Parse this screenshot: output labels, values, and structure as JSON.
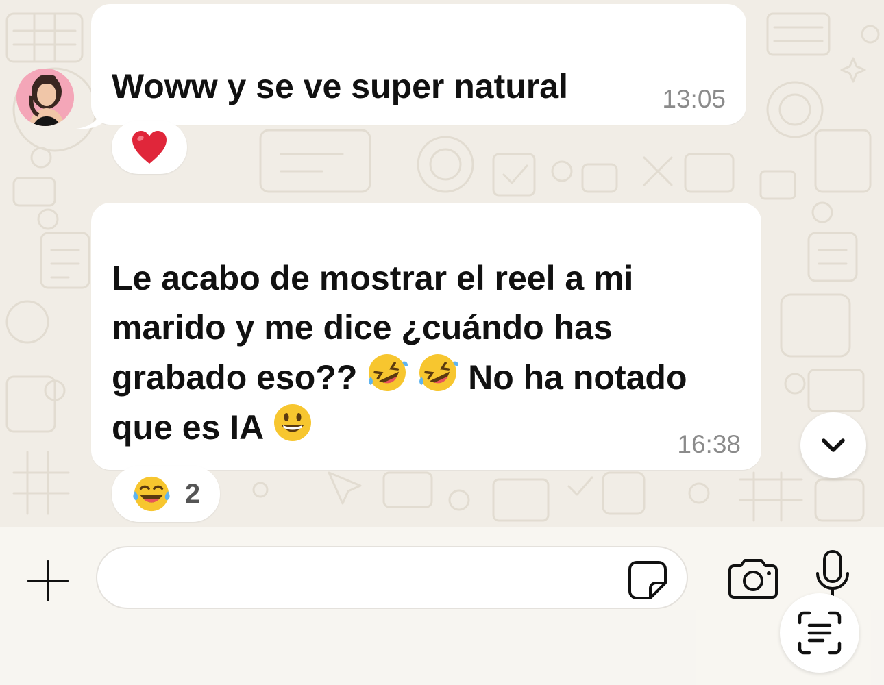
{
  "chat": {
    "messages": [
      {
        "text": "Woww y se ve super natural",
        "time": "13:05",
        "reaction": {
          "emoji": "red-heart",
          "count": ""
        }
      },
      {
        "text_parts": [
          "Le acabo de mostrar el reel a mi marido y me dice ¿cuándo has grabado eso??",
          "No ha notado que es IA"
        ],
        "inline_emojis": [
          "rolling-on-floor-laughing",
          "rolling-on-floor-laughing",
          "grinning-face"
        ],
        "time": "16:38",
        "reaction": {
          "emoji": "tears-of-joy",
          "count": "2"
        }
      }
    ]
  },
  "composer": {
    "input_value": "",
    "icons": [
      "plus-icon",
      "sticker-icon",
      "camera-icon",
      "microphone-icon",
      "text-scan-icon"
    ]
  },
  "colors": {
    "background": "#f1ede6",
    "bubble": "#ffffff",
    "timestamp": "#8b8b8b",
    "heart": "#e0263a",
    "emoji_yellow": "#f7c62f"
  }
}
